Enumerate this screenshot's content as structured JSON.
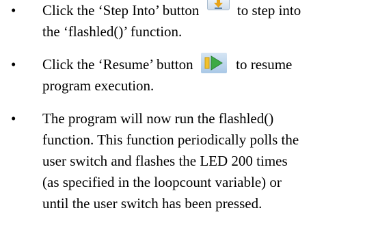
{
  "items": [
    {
      "lines": [
        {
          "before": "Click the ‘Step Into’ button ",
          "after": " to step into"
        },
        {
          "text": "the ‘flashled()’ function."
        }
      ],
      "icon": "step-into-icon"
    },
    {
      "lines": [
        {
          "before": "Click the ‘Resume’ button ",
          "after": " to resume"
        },
        {
          "text": "program execution."
        }
      ],
      "icon": "resume-icon"
    },
    {
      "lines": [
        {
          "text": "The program will now run the flashled()"
        },
        {
          "text": "function. This function periodically polls the"
        },
        {
          "text": "user switch and flashes the LED 200 times"
        },
        {
          "text": "(as specified in the loopcount variable) or"
        },
        {
          "text": "until the user switch has been pressed."
        }
      ]
    }
  ],
  "bullet_glyph": "•",
  "colors": {
    "text": "#000000",
    "step_into_arrow": "#e8a317",
    "resume_bar": "#f2c12e",
    "resume_triangle": "#3daa45"
  }
}
